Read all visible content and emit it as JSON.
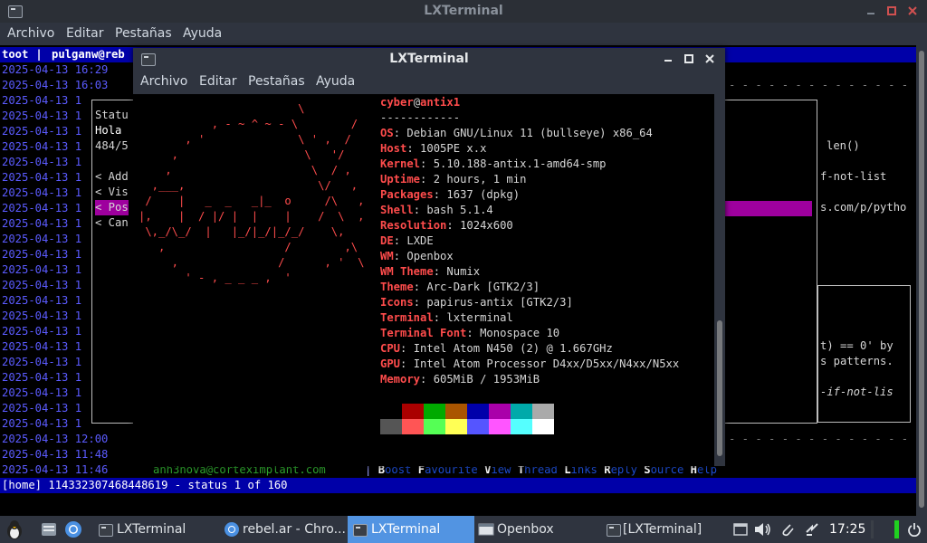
{
  "back_window": {
    "title": "LXTerminal",
    "menu": [
      "Archivo",
      "Editar",
      "Pestañas",
      "Ayuda"
    ],
    "header": {
      "user": "toot",
      "sep": " | ",
      "account": "pulganw@reb"
    },
    "timestamps": [
      "2025-04-13 16:29",
      "2025-04-13 16:03",
      "2025-04-13 1",
      "2025-04-13 1",
      "2025-04-13 1",
      "2025-04-13 1",
      "2025-04-13 1",
      "2025-04-13 1",
      "2025-04-13 1",
      "2025-04-13 1",
      "2025-04-13 1",
      "2025-04-13 1",
      "2025-04-13 1",
      "2025-04-13 1",
      "2025-04-13 1",
      "2025-04-13 1",
      "2025-04-13 1",
      "2025-04-13 1",
      "2025-04-13 1",
      "2025-04-13 1",
      "2025-04-13 1",
      "2025-04-13 1",
      "2025-04-13 1",
      "2025-04-13 1",
      "2025-04-13 12:00",
      "2025-04-13 11:48",
      "2025-04-13 11:46"
    ],
    "dialog": {
      "l1": "Statu",
      "l2": "Hola ",
      "l3": "484/5",
      "o1": "< Add",
      "o2": "< Vis",
      "o3": "< Pos",
      "o4": "< Can"
    },
    "right_text": {
      "r1": "len()",
      "r2": "f-not-list",
      "r3": "s.com/p/pytho",
      "r4": "t) == 0' by",
      "r5": "s patterns.",
      "r6": "-if-not-lis"
    },
    "bottom_author": "anh3nova@corteximplant.com",
    "bottom_keys": "Boost Favourite View Thread Links Reply Source Help",
    "status": "[home] 114332307468448619 - status 1 of 160"
  },
  "front_window": {
    "title": "LXTerminal",
    "menu": [
      "Archivo",
      "Editar",
      "Pestañas",
      "Ayuda"
    ],
    "ascii_art": "                        \\\n           , - ~ ^ ~ - \\        /\n       , '              \\ ' ,  /\n     ,                   \\   '/\n    ,                     \\  / ,\n  ,___,                    \\/   ,\n /    |   _  _   _|_  o     /\\   ,\n|,    |  / |/ |  |    |    /  \\  ,\n \\,_/\\_/  |   |_/|_/|_/_/    \\,\n   ,                  /        ,\\\n     ,               /      , '  \\\n       ' - , _ _ _ ,  '",
    "user": "cyber",
    "at": "@",
    "host": "antix1",
    "separator": "------------",
    "info": [
      {
        "k": "OS",
        "v": "Debian GNU/Linux 11 (bullseye) x86_64"
      },
      {
        "k": "Host",
        "v": "1005PE x.x"
      },
      {
        "k": "Kernel",
        "v": "5.10.188-antix.1-amd64-smp"
      },
      {
        "k": "Uptime",
        "v": "2 hours, 1 min"
      },
      {
        "k": "Packages",
        "v": "1637 (dpkg)"
      },
      {
        "k": "Shell",
        "v": "bash 5.1.4"
      },
      {
        "k": "Resolution",
        "v": "1024x600"
      },
      {
        "k": "DE",
        "v": "LXDE"
      },
      {
        "k": "WM",
        "v": "Openbox"
      },
      {
        "k": "WM Theme",
        "v": "Numix"
      },
      {
        "k": "Theme",
        "v": "Arc-Dark [GTK2/3]"
      },
      {
        "k": "Icons",
        "v": "papirus-antix [GTK2/3]"
      },
      {
        "k": "Terminal",
        "v": "lxterminal"
      },
      {
        "k": "Terminal Font",
        "v": "Monospace 10"
      },
      {
        "k": "CPU",
        "v": "Intel Atom N450 (2) @ 1.667GHz"
      },
      {
        "k": "GPU",
        "v": "Intel Atom Processor D4xx/D5xx/N4xx/N5xx"
      },
      {
        "k": "Memory",
        "v": "605MiB / 1953MiB"
      }
    ],
    "palette_top": [
      "#000000",
      "#aa0000",
      "#00aa00",
      "#aa5500",
      "#0000aa",
      "#aa00aa",
      "#00aaaa",
      "#aaaaaa"
    ],
    "palette_bottom": [
      "#555555",
      "#ff5555",
      "#55ff55",
      "#ffff55",
      "#5555ff",
      "#ff55ff",
      "#55ffff",
      "#ffffff"
    ]
  },
  "taskbar": {
    "tasks": [
      "LXTerminal",
      "rebel.ar - Chro...",
      "LXTerminal",
      "Openbox",
      "[LXTerminal]"
    ],
    "clock": "17:25"
  }
}
